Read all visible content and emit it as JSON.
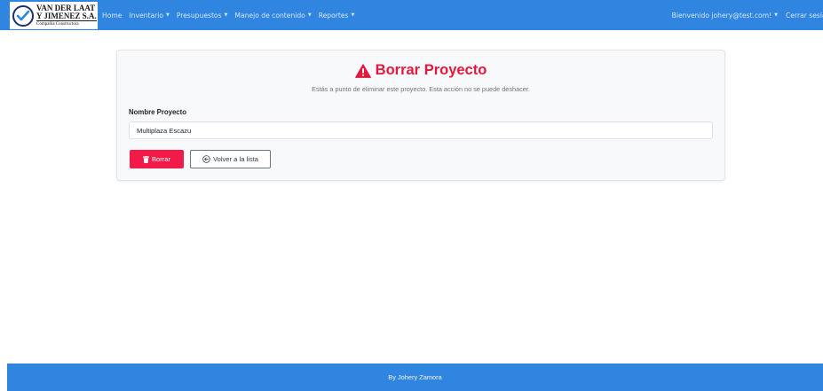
{
  "brand": {
    "line1": "VAN DER LAAT",
    "line2": "Y JIMENEZ S.A.",
    "line3": "Compañía Constructora"
  },
  "nav": {
    "items": [
      {
        "label": "Home",
        "dropdown": false
      },
      {
        "label": "Inventario",
        "dropdown": true
      },
      {
        "label": "Presupuestos",
        "dropdown": true
      },
      {
        "label": "Manejo de contenido",
        "dropdown": true
      },
      {
        "label": "Reportes",
        "dropdown": true
      }
    ],
    "user_label": "Bienvenido johery@test.com!",
    "logout_label": "Cerrar sesión"
  },
  "card": {
    "title": "Borrar Proyecto",
    "subtitle": "Estás a punto de eliminar este proyecto. Esta acción no se puede deshacer.",
    "field_label": "Nombre Proyecto",
    "field_value": "Multiplaza Escazu",
    "delete_label": "Borrar",
    "back_label": "Volver a la lista"
  },
  "footer": {
    "text": "By Johery Zamora"
  },
  "colors": {
    "navbar": "#2f85e0",
    "danger": "#f21a48",
    "title": "#e4173d"
  },
  "icons": {
    "warning": "warning-triangle-icon",
    "delete": "trash-icon",
    "back": "arrow-left-circle-icon"
  }
}
